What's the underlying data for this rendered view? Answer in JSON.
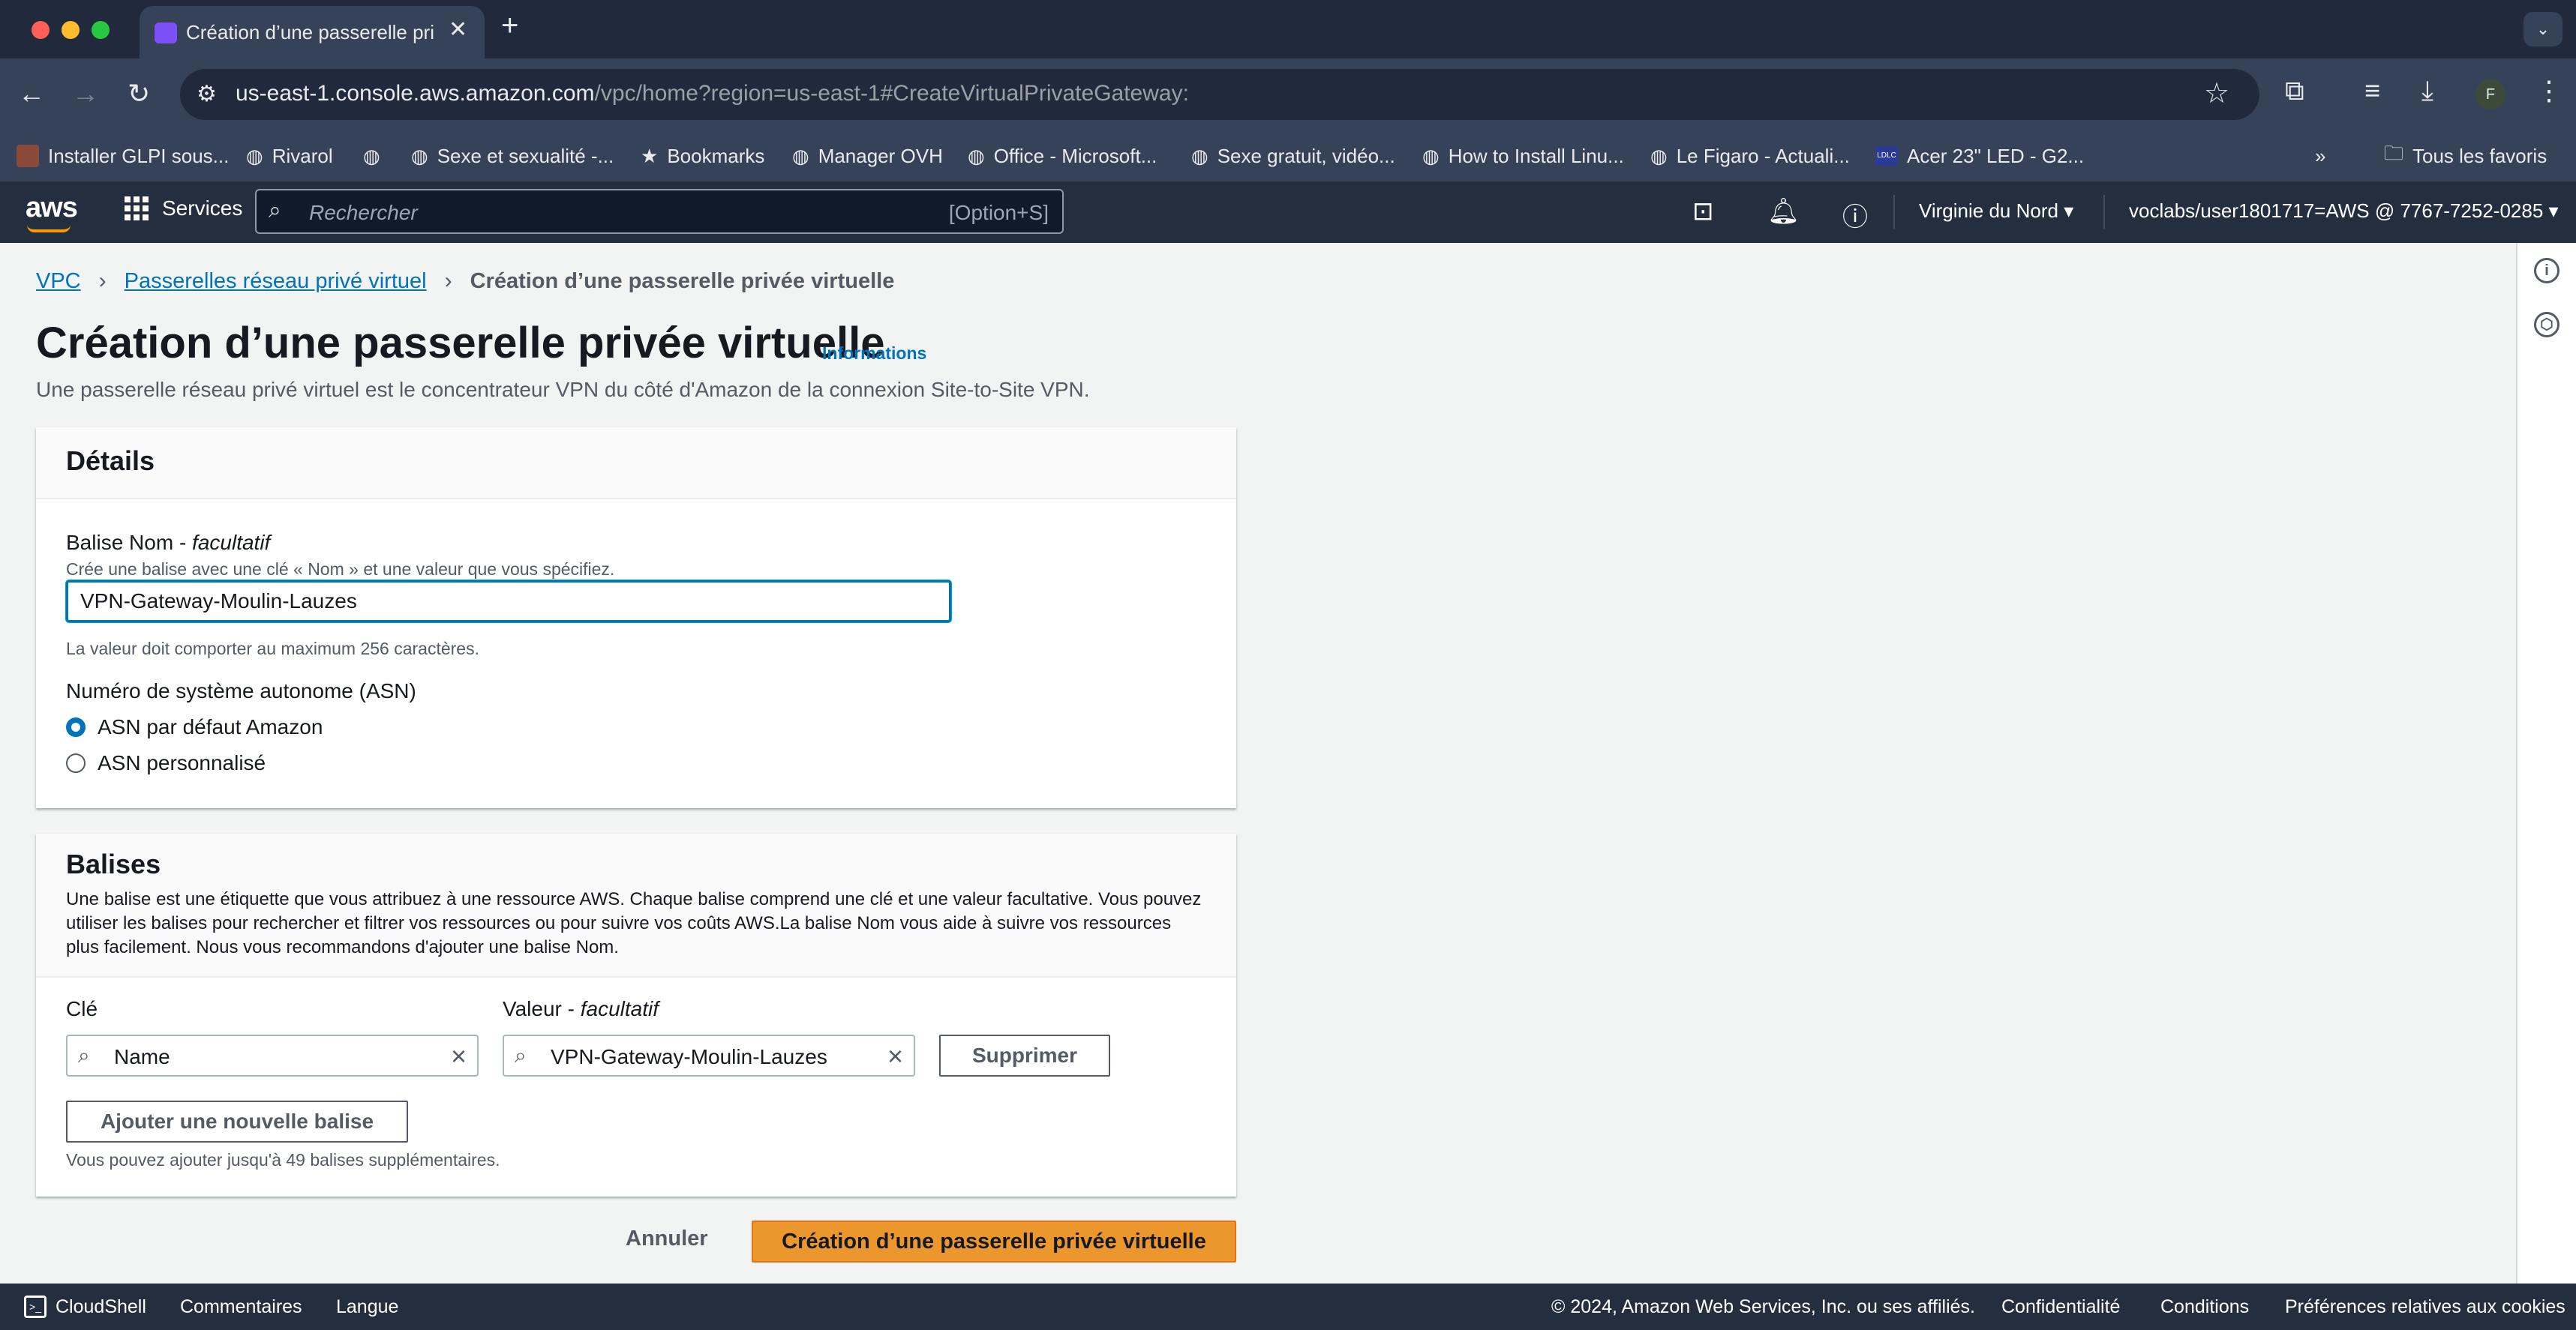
{
  "browser": {
    "tab_title": "Création d’une passerelle privée virtuelle",
    "url_host": "us-east-1.console.aws.amazon.com",
    "url_path": "/vpc/home?region=us-east-1#CreateVirtualPrivateGateway:",
    "profile_initial": "F",
    "bookmarks": [
      {
        "label": "Installer GLPI sous..."
      },
      {
        "label": "Rivarol"
      },
      {
        "label": ""
      },
      {
        "label": "Sexe et sexualité -..."
      },
      {
        "label": "Bookmarks"
      },
      {
        "label": "Manager OVH"
      },
      {
        "label": "Office - Microsoft..."
      },
      {
        "label": "Sexe gratuit, vidéo..."
      },
      {
        "label": "How to Install Linu..."
      },
      {
        "label": "Le Figaro - Actuali..."
      },
      {
        "label": "Acer 23\" LED - G2..."
      }
    ],
    "all_bookmarks": "Tous les favoris"
  },
  "aws_nav": {
    "logo": "aws",
    "services": "Services",
    "search_placeholder": "Rechercher",
    "search_shortcut": "[Option+S]",
    "region": "Virginie du Nord",
    "account": "voclabs/user1801717=AWS @ 7767-7252-0285"
  },
  "breadcrumb": {
    "item1": "VPC",
    "item2": "Passerelles réseau privé virtuel",
    "current": "Création d’une passerelle privée virtuelle"
  },
  "page": {
    "title": "Création d’une passerelle privée virtuelle",
    "info_link": "Informations",
    "description": "Une passerelle réseau privé virtuel est le concentrateur VPN du côté d'Amazon de la connexion Site-to-Site VPN."
  },
  "details": {
    "heading": "Détails",
    "name_label": "Balise Nom - ",
    "name_label_optional": "facultatif",
    "name_desc": "Crée une balise avec une clé « Nom » et une valeur que vous spécifiez.",
    "name_value": "VPN-Gateway-Moulin-Lauzes",
    "name_constraint": "La valeur doit comporter au maximum 256 caractères.",
    "asn_label": "Numéro de système autonome (ASN)",
    "asn_options": [
      {
        "label": "ASN par défaut Amazon",
        "selected": true
      },
      {
        "label": "ASN personnalisé",
        "selected": false
      }
    ]
  },
  "tags": {
    "heading": "Balises",
    "description": "Une balise est une étiquette que vous attribuez à une ressource AWS. Chaque balise comprend une clé et une valeur facultative. Vous pouvez utiliser les balises pour rechercher et filtrer vos ressources ou pour suivre vos coûts AWS.La balise Nom vous aide à suivre vos ressources plus facilement. Nous vous recommandons d'ajouter une balise Nom.",
    "key_label": "Clé",
    "value_label": "Valeur - ",
    "value_label_optional": "facultatif",
    "key_value": "Name",
    "value_value": "VPN-Gateway-Moulin-Lauzes",
    "remove_button": "Supprimer",
    "add_button": "Ajouter une nouvelle balise",
    "limit_note": "Vous pouvez ajouter jusqu'à 49 balises supplémentaires."
  },
  "actions": {
    "cancel": "Annuler",
    "submit": "Création d’une passerelle privée virtuelle"
  },
  "footer": {
    "cloudshell": "CloudShell",
    "feedback": "Commentaires",
    "language": "Langue",
    "copyright": "© 2024, Amazon Web Services, Inc. ou ses affiliés.",
    "privacy": "Confidentialité",
    "terms": "Conditions",
    "cookies": "Préférences relatives aux cookies"
  },
  "colors": {
    "primary_button": "#ec972e",
    "link": "#0073bb",
    "aws_nav_bg": "#232f3e",
    "browser_bg": "#354258"
  }
}
